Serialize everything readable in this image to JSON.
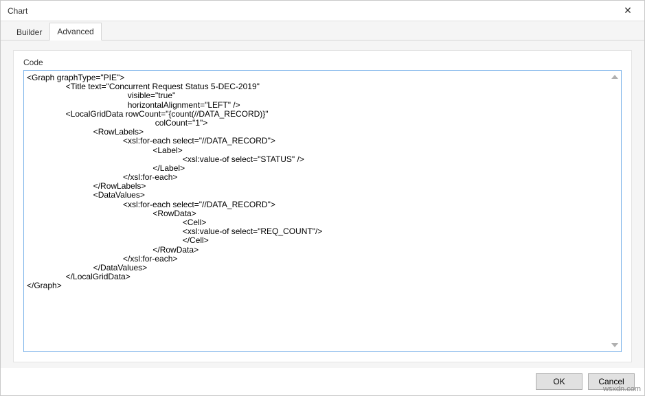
{
  "dialog": {
    "title": "Chart",
    "close_symbol": "✕"
  },
  "tabs": {
    "builder": "Builder",
    "advanced": "Advanced"
  },
  "panel": {
    "code_label": "Code",
    "code_value": "<Graph graphType=\"PIE\">\n                 <Title text=\"Concurrent Request Status 5-DEC-2019\"\n                                            visible=\"true\"\n                                            horizontalAlignment=\"LEFT\" />\n                 <LocalGridData rowCount=\"{count(//DATA_RECORD)}\"\n                                                        colCount=\"1\">\n                             <RowLabels>\n                                          <xsl:for-each select=\"//DATA_RECORD\">\n                                                       <Label>\n                                                                    <xsl:value-of select=\"STATUS\" />\n                                                       </Label>\n                                          </xsl:for-each>\n                             </RowLabels>\n                             <DataValues>\n                                          <xsl:for-each select=\"//DATA_RECORD\">\n                                                       <RowData>\n                                                                    <Cell>\n                                                                    <xsl:value-of select=\"REQ_COUNT\"/>\n                                                                    </Cell>\n                                                       </RowData>\n                                          </xsl:for-each>\n                             </DataValues>\n                 </LocalGridData>\n</Graph>"
  },
  "buttons": {
    "ok": "OK",
    "cancel": "Cancel"
  },
  "watermark": "wsxdn.com"
}
